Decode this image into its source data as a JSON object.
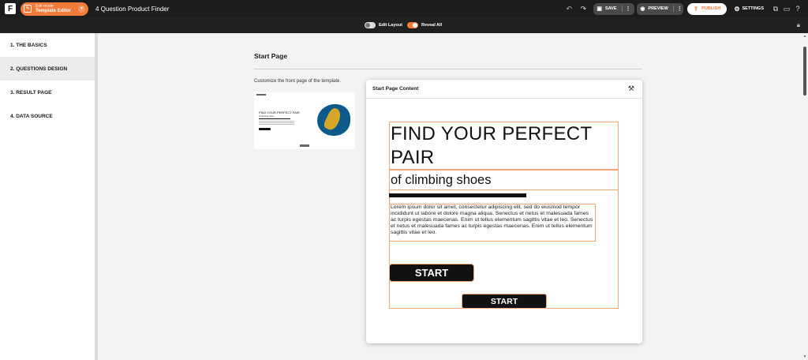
{
  "topbar": {
    "logo_letter": "F",
    "mode_small": "Edit mode",
    "mode_main": "Template Editor",
    "app_title": "4 Question Product Finder",
    "save_label": "SAVE",
    "preview_label": "PREVIEW",
    "publish_label": "PUBLISH",
    "settings_label": "SETTINGS",
    "accent": "#f37b3a"
  },
  "subbar": {
    "edit_layout_label": "Edit Layout",
    "reveal_all_label": "Reveal All"
  },
  "sidebar": {
    "items": [
      {
        "label": "1. THE BASICS"
      },
      {
        "label": "2. QUESTIONS DESIGN"
      },
      {
        "label": "3. RESULT PAGE"
      },
      {
        "label": "4. DATA SOURCE"
      }
    ]
  },
  "main": {
    "section_title": "Start Page",
    "description": "Customize the front page of the template.",
    "thumb_title": "FIND YOUR PERFECT PAIR",
    "thumb_subtitle": "of climbing shoes"
  },
  "panel": {
    "title": "Start Page Content",
    "heading": "FIND YOUR PERFECT PAIR",
    "subheading": "of climbing shoes",
    "paragraph": "Lorem ipsum dolor sit amet, consectetur adipiscing elit, sed do eiusmod tempor incididunt ut labore et dolore magna aliqua. Senectus et netus et malesuada fames ac turpis egestas maecenas. Enim ut tellus elementum sagittis vitae et leo. Senectus et netus et malesuada fames ac turpis egestas maecenas. Enim ut tellus elementum sagittis vitae et leo.",
    "start_label_1": "START",
    "start_label_2": "START"
  }
}
